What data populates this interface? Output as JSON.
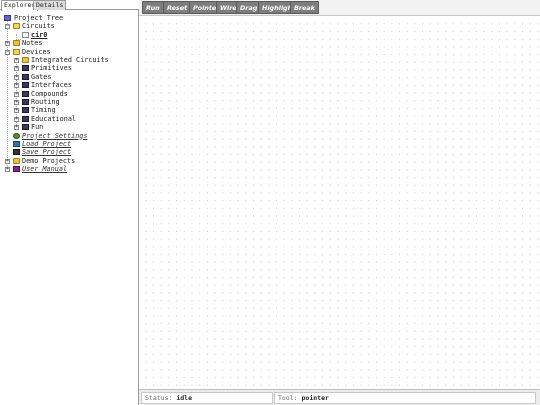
{
  "tabs": [
    "Explorer",
    "Details"
  ],
  "tree": {
    "root": "Project Tree",
    "circuits": "Circuits",
    "cir0": "cir0",
    "notes": "Notes",
    "devices": "Devices",
    "device_items": [
      "Integrated Circuits",
      "Primitives",
      "Gates",
      "Interfaces",
      "Compounds",
      "Routing",
      "Timing",
      "Educational",
      "Fun"
    ],
    "project_settings": "Project Settings",
    "load_project": "Load Project",
    "save_project": "Save Project",
    "demo_projects": "Demo Projects",
    "user_manual": "User Manual"
  },
  "toolbar": {
    "run": "Run",
    "reset": "Reset",
    "pointer": "Pointer",
    "wire": "Wire",
    "drag": "Drag",
    "highlight": "Highlight",
    "break": "Break"
  },
  "status": {
    "status_label": "Status:",
    "status_value": "idle",
    "tool_label": "Tool:",
    "tool_value": "pointer"
  }
}
